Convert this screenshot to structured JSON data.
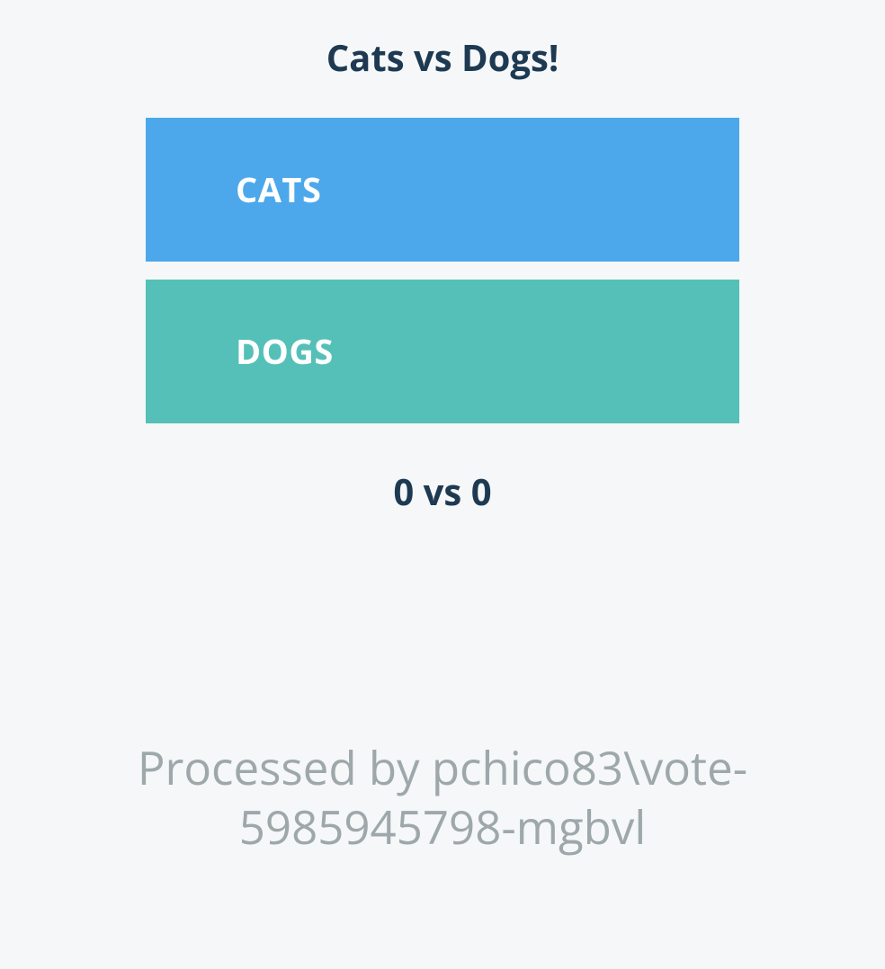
{
  "title": "Cats vs Dogs!",
  "buttons": {
    "cats": {
      "label": "CATS"
    },
    "dogs": {
      "label": "DOGS"
    }
  },
  "score_text": "0 vs 0",
  "footer_text": "Processed by pchico83\\vote-5985945798-mgbvl"
}
